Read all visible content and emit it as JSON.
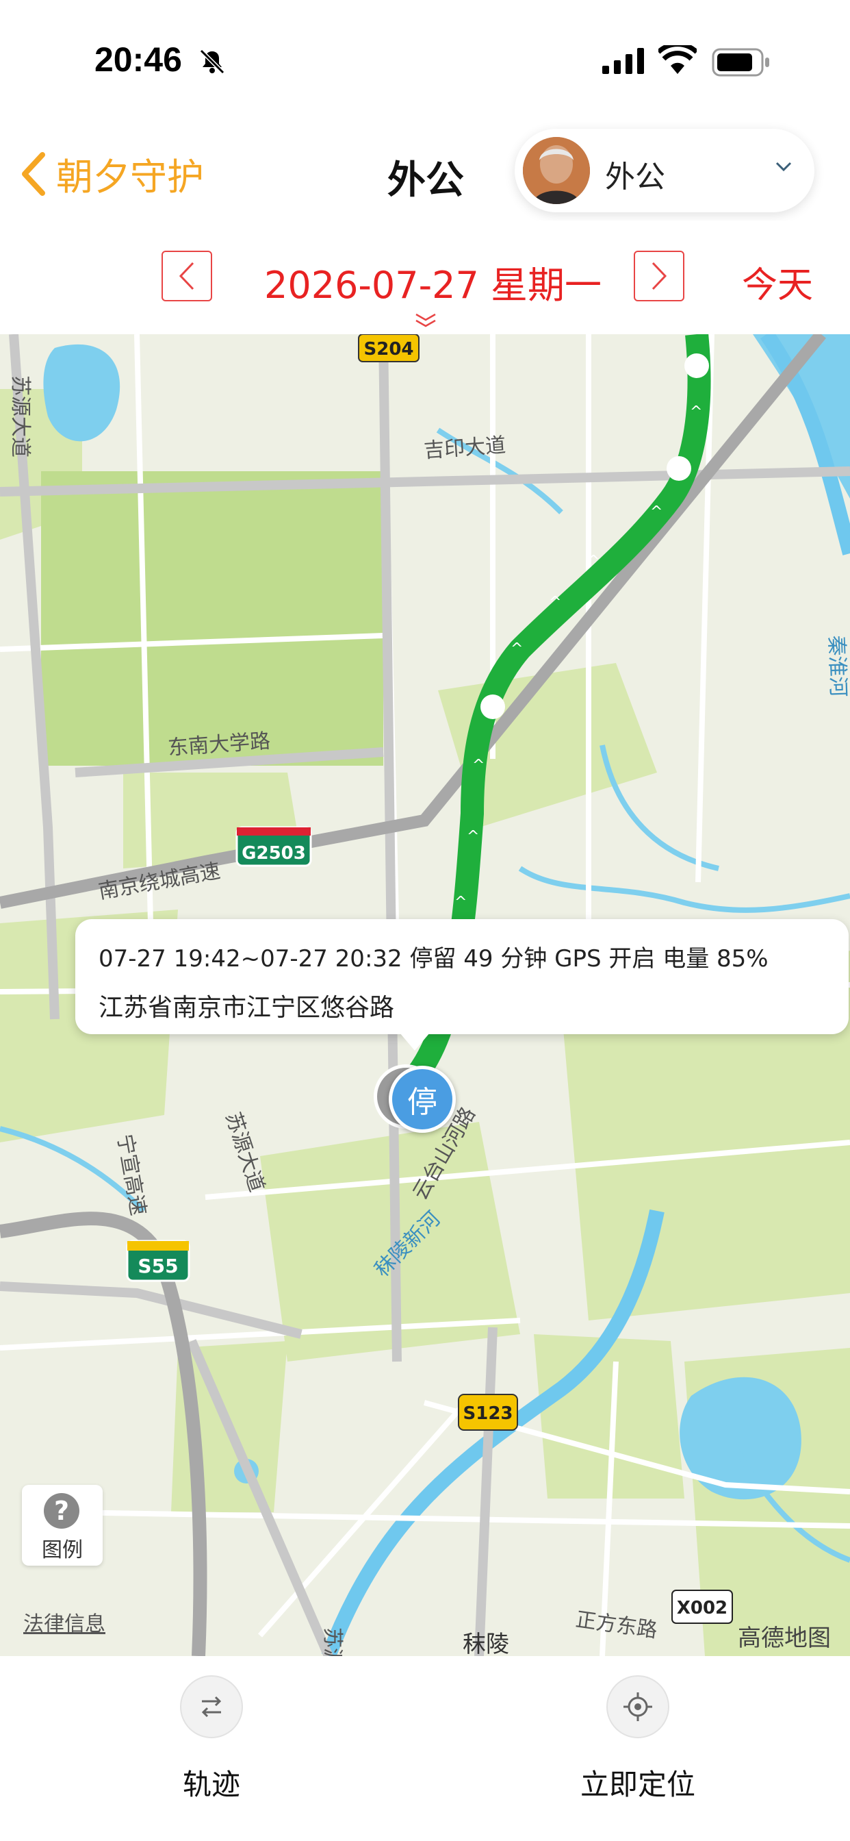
{
  "status_bar": {
    "time": "20:46"
  },
  "nav": {
    "back_label": "朝夕守护",
    "title": "外公",
    "user_name": "外公"
  },
  "date_bar": {
    "date": "2026-07-27 星期一",
    "today_label": "今天"
  },
  "map": {
    "roads": [
      "苏源大道",
      "吉印大道",
      "东南大学路",
      "南京绕城高速",
      "宁宣高速",
      "苏源大道",
      "云台山河路",
      "正方东路",
      "苏源"
    ],
    "rivers": [
      "秦淮河",
      "秣陵新河"
    ],
    "shields": [
      "S204",
      "G2503",
      "S55",
      "S123",
      "X002"
    ],
    "places": [
      "秣陵"
    ],
    "legal_label": "法律信息",
    "provider": "高德地图"
  },
  "stop_info": {
    "line1": "07-27 19:42~07-27 20:32 停留 49 分钟 GPS 开启 电量 85%",
    "address": "江苏省南京市江宁区悠谷路"
  },
  "stop_marker_label": "停",
  "legend": {
    "label": "图例",
    "icon_text": "?"
  },
  "bottom": {
    "track_label": "轨迹",
    "locate_label": "立即定位"
  },
  "colors": {
    "accent": "#f5a623",
    "date_red": "#e82222",
    "route_green": "#22c04a",
    "water": "#7ecfee",
    "park": "#cfe4a4"
  },
  "battery": {
    "level": 0.85
  }
}
